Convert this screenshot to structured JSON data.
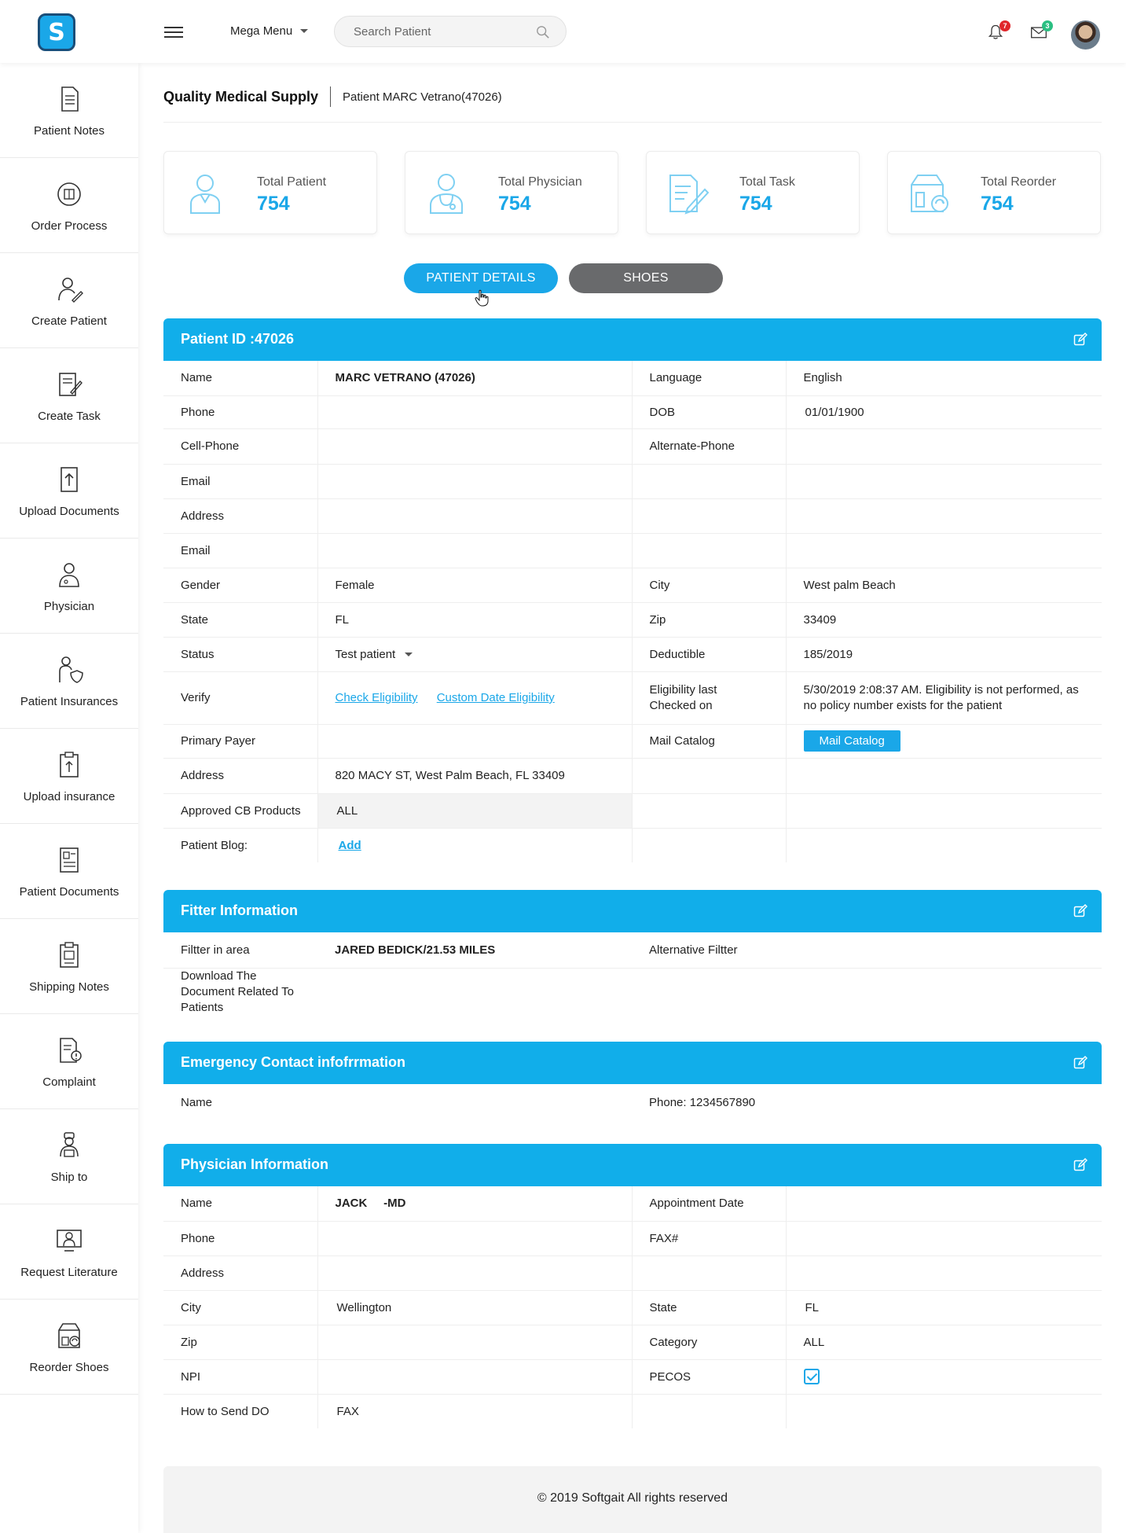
{
  "header": {
    "logo_letter": "S",
    "mega_menu": "Mega Menu",
    "search_placeholder": "Search Patient",
    "notifications_count": "7",
    "messages_count": "3"
  },
  "sidebar": {
    "items": [
      {
        "label": "Patient Notes",
        "icon": "notes-icon"
      },
      {
        "label": "Order Process",
        "icon": "order-process-icon"
      },
      {
        "label": "Create Patient",
        "icon": "create-patient-icon"
      },
      {
        "label": "Create Task",
        "icon": "create-task-icon"
      },
      {
        "label": "Upload Documents",
        "icon": "upload-documents-icon"
      },
      {
        "label": "Physician",
        "icon": "physician-icon"
      },
      {
        "label": "Patient Insurances",
        "icon": "patient-insurances-icon"
      },
      {
        "label": "Upload insurance",
        "icon": "upload-insurance-icon"
      },
      {
        "label": "Patient  Documents",
        "icon": "patient-documents-icon"
      },
      {
        "label": "Shipping Notes",
        "icon": "shipping-notes-icon"
      },
      {
        "label": "Complaint",
        "icon": "complaint-icon"
      },
      {
        "label": "Ship to",
        "icon": "ship-to-icon"
      },
      {
        "label": "Request Literature",
        "icon": "request-literature-icon"
      },
      {
        "label": "Reorder Shoes",
        "icon": "reorder-shoes-icon"
      }
    ]
  },
  "breadcrumb": {
    "company": "Quality Medical Supply",
    "patient": "Patient MARC Vetrano(47026)"
  },
  "stats": [
    {
      "label": "Total Patient",
      "value": "754"
    },
    {
      "label": "Total Physician",
      "value": "754"
    },
    {
      "label": "Total Task",
      "value": "754"
    },
    {
      "label": "Total Reorder",
      "value": "754"
    }
  ],
  "tabs": {
    "patient_details": "PATIENT DETAILS",
    "shoes": "SHOES"
  },
  "patient": {
    "title": "Patient ID :47026",
    "rows": [
      [
        "Name",
        "MARC VETRANO (47026)",
        "Language",
        "English"
      ],
      [
        "Phone",
        "",
        "DOB",
        "01/01/1900"
      ],
      [
        "Cell-Phone",
        "",
        "Alternate-Phone",
        ""
      ],
      [
        "Email",
        "",
        "",
        ""
      ],
      [
        "Address",
        "",
        "",
        ""
      ],
      [
        "Email",
        "",
        "",
        ""
      ],
      [
        "Gender",
        "Female",
        "City",
        "West palm Beach"
      ],
      [
        "State",
        "FL",
        "Zip",
        "33409"
      ],
      [
        "Status",
        "Test patient",
        "Deductible",
        "185/2019"
      ],
      [
        "Verify",
        "",
        "Eligibility last Checked on",
        "5/30/2019 2:08:37 AM. Eligibility is not performed, as no policy number exists for the patient"
      ],
      [
        "Primary Payer",
        "",
        "Mail Catalog",
        ""
      ],
      [
        "Address",
        "820 MACY ST, West Palm Beach, FL 33409",
        "",
        ""
      ],
      [
        "Approved CB Products",
        "ALL",
        "",
        ""
      ],
      [
        "Patient Blog:",
        "",
        "",
        ""
      ]
    ],
    "check_eligibility": "Check Eligibility",
    "custom_date_eligibility": "Custom Date Eligibility",
    "mail_catalog_button": "Mail Catalog",
    "add_link": "Add"
  },
  "fitter": {
    "title": "Fitter Information",
    "in_area_label": "Filtter in area",
    "in_area_value": "JARED BEDICK/21.53 MILES",
    "alternative_label": "Alternative Filtter",
    "download_label": "Download The Document Related To Patients"
  },
  "emergency": {
    "title": "Emergency Contact infofrrmation",
    "name_label": "Name",
    "phone_text": "Phone: 1234567890"
  },
  "physician": {
    "title": "Physician Information",
    "rows": [
      [
        "Name",
        "JACK     -MD",
        "Appointment Date",
        ""
      ],
      [
        "Phone",
        "",
        "FAX#",
        ""
      ],
      [
        "Address",
        "",
        "",
        ""
      ],
      [
        "City",
        "Wellington",
        "State",
        "FL"
      ],
      [
        "Zip",
        "",
        "Category",
        "ALL"
      ],
      [
        "NPI",
        "",
        "PECOS",
        ""
      ],
      [
        "How to Send DO",
        "FAX",
        "",
        ""
      ]
    ],
    "pecos_checked": true
  },
  "footer": {
    "text": "© 2019 Softgait All rights reserved"
  },
  "colors": {
    "accent": "#1aa7e8",
    "header_blue": "#11aeea",
    "tab_gray": "#696a6c"
  }
}
